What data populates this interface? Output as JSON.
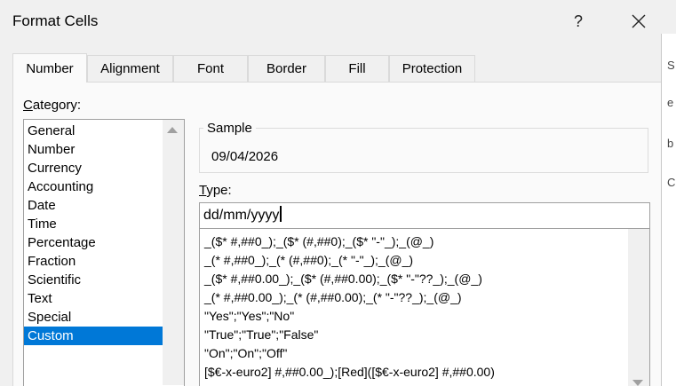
{
  "dialog": {
    "title": "Format Cells",
    "help_label": "?"
  },
  "tabs": [
    {
      "label": "Number"
    },
    {
      "label": "Alignment"
    },
    {
      "label": "Font"
    },
    {
      "label": "Border"
    },
    {
      "label": "Fill"
    },
    {
      "label": "Protection"
    }
  ],
  "category": {
    "label_accel": "C",
    "label_rest": "ategory:",
    "items": [
      "General",
      "Number",
      "Currency",
      "Accounting",
      "Date",
      "Time",
      "Percentage",
      "Fraction",
      "Scientific",
      "Text",
      "Special",
      "Custom"
    ],
    "selected": "Custom"
  },
  "sample": {
    "label": "Sample",
    "value": "09/04/2026"
  },
  "type": {
    "label_accel": "T",
    "label_rest": "ype:",
    "value": "dd/mm/yyyy",
    "formats": [
      "_($* #,##0_);_($* (#,##0);_($* \"-\"_);_(@_)",
      "_(* #,##0_);_(* (#,##0);_(* \"-\"_);_(@_)",
      "_($* #,##0.00_);_($* (#,##0.00);_($* \"-\"??_);_(@_)",
      "_(* #,##0.00_);_(* (#,##0.00);_(* \"-\"??_);_(@_)",
      "\"Yes\";\"Yes\";\"No\"",
      "\"True\";\"True\";\"False\"",
      "\"On\";\"On\";\"Off\"",
      "[$€-x-euro2] #,##0.00_);[Red]([$€-x-euro2] #,##0.00)"
    ]
  },
  "background_fragments": [
    "S",
    "e",
    "b",
    "C"
  ],
  "colors": {
    "selection": "#0078d7",
    "dialog_bg": "#f0f0f0",
    "panel_bg": "#fafafa"
  }
}
